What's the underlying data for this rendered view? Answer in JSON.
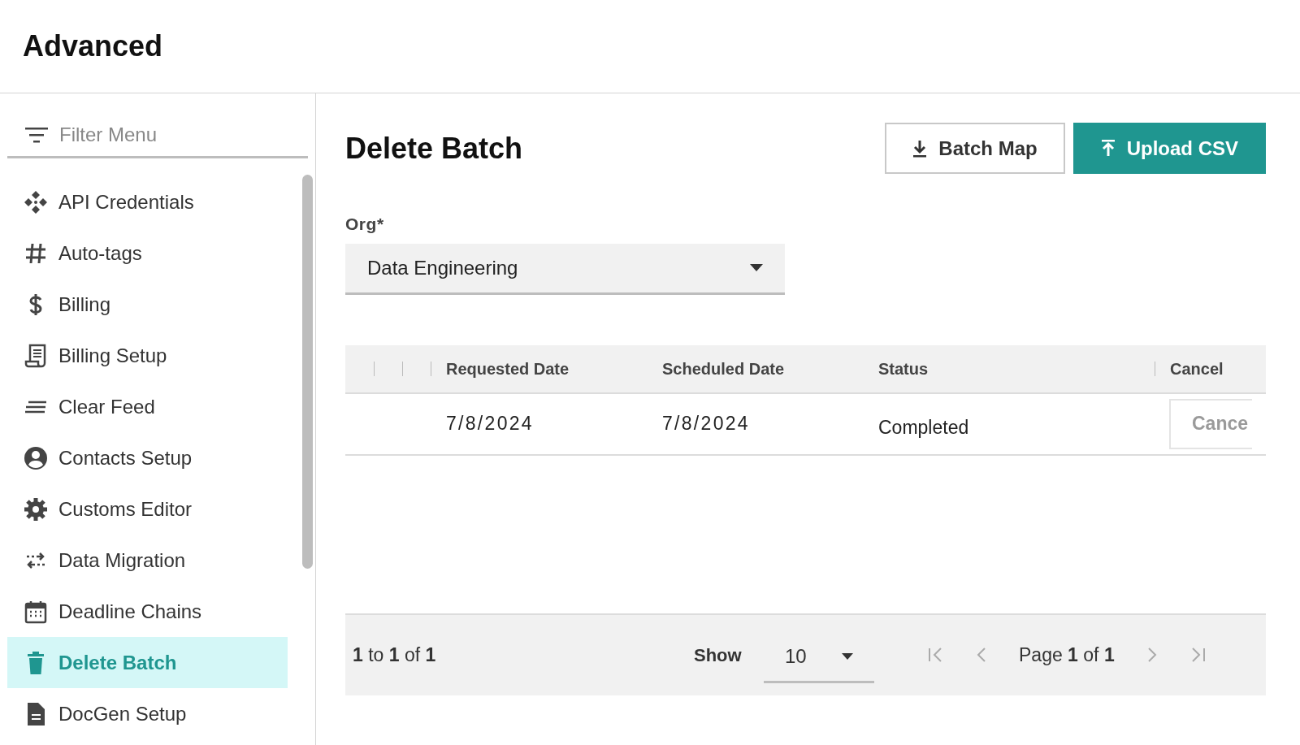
{
  "header": {
    "title": "Advanced"
  },
  "sidebar": {
    "filter": {
      "placeholder": "Filter Menu"
    },
    "items": [
      {
        "label": "API Credentials",
        "kind": "diamond",
        "selected": false
      },
      {
        "label": "Auto-tags",
        "kind": "hash",
        "selected": false
      },
      {
        "label": "Billing",
        "kind": "dollar",
        "selected": false
      },
      {
        "label": "Billing Setup",
        "kind": "receipt",
        "selected": false
      },
      {
        "label": "Clear Feed",
        "kind": "lines",
        "selected": false
      },
      {
        "label": "Contacts Setup",
        "kind": "person",
        "selected": false
      },
      {
        "label": "Customs Editor",
        "kind": "gear",
        "selected": false
      },
      {
        "label": "Data Migration",
        "kind": "arrows",
        "selected": false
      },
      {
        "label": "Deadline Chains",
        "kind": "calendar",
        "selected": false
      },
      {
        "label": "Delete Batch",
        "kind": "trash",
        "selected": true
      },
      {
        "label": "DocGen Setup",
        "kind": "document",
        "selected": false
      }
    ]
  },
  "main": {
    "title": "Delete Batch",
    "buttons": [
      {
        "label": "Batch Map",
        "kind": "download"
      },
      {
        "label": "Upload CSV",
        "kind": "upload"
      }
    ],
    "org": {
      "label": "Org*",
      "value": "Data Engineering"
    },
    "table": {
      "columns": [
        "Requested Date",
        "Scheduled Date",
        "Status",
        "Cancel"
      ],
      "rows": [
        {
          "requested": "7/8/2024",
          "scheduled": "7/8/2024",
          "status": "Completed",
          "action": "Cance",
          "action_disabled": true
        }
      ]
    },
    "pagination": {
      "range": "**1** to **1** of **1**",
      "show_label": "Show",
      "page_size": "10",
      "page": "Page **1** of **1**"
    }
  }
}
